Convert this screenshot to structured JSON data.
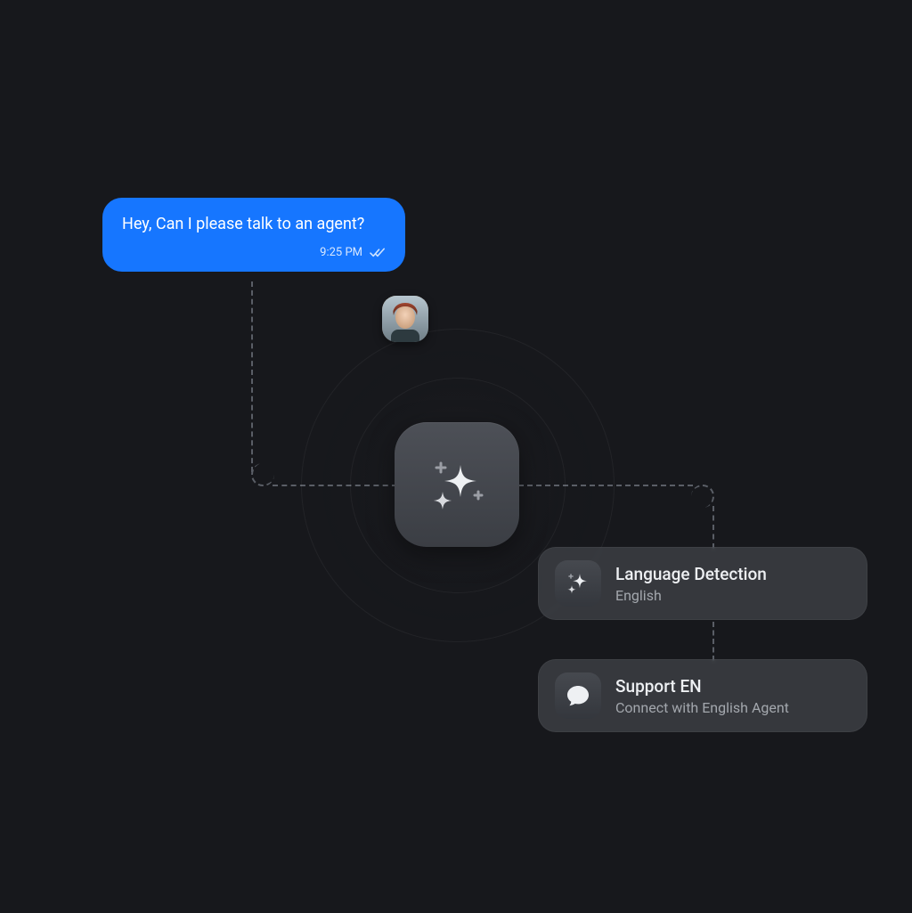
{
  "chat": {
    "text": "Hey, Can I please talk to an agent?",
    "time": "9:25 PM"
  },
  "cards": {
    "language": {
      "title": "Language Detection",
      "subtitle": "English"
    },
    "support": {
      "title": "Support EN",
      "subtitle": "Connect with English Agent"
    }
  }
}
